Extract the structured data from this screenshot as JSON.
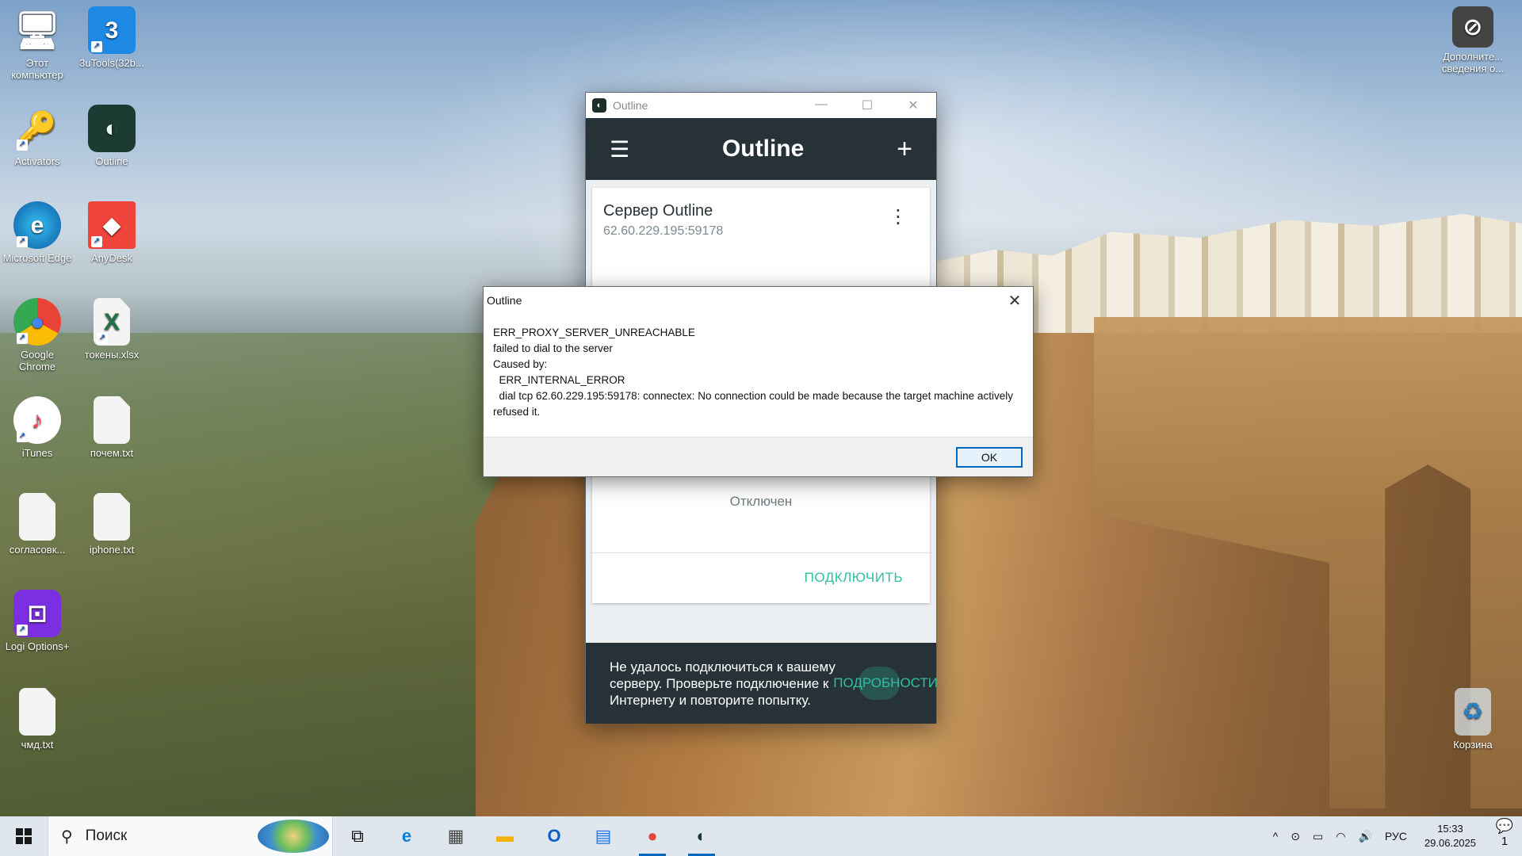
{
  "desktop": {
    "icons": [
      {
        "label": "Этот компьютер",
        "glyph": "🖥"
      },
      {
        "label": "3uTools(32b...",
        "glyph": "3"
      },
      {
        "label": "Activators",
        "glyph": "🔑"
      },
      {
        "label": "Outline",
        "glyph": "◐"
      },
      {
        "label": "Microsoft Edge",
        "glyph": "e"
      },
      {
        "label": "AnyDesk",
        "glyph": "◆"
      },
      {
        "label": "Google Chrome",
        "glyph": "●"
      },
      {
        "label": "токены.xlsx",
        "glyph": "X"
      },
      {
        "label": "iTunes",
        "glyph": "♪"
      },
      {
        "label": "почем.txt",
        "glyph": ""
      },
      {
        "label": "согласовк...",
        "glyph": ""
      },
      {
        "label": "iphone.txt",
        "glyph": ""
      },
      {
        "label": "Logi Options+",
        "glyph": "⊡"
      },
      {
        "label": "чмд.txt",
        "glyph": ""
      },
      {
        "label": "Дополните... сведения о...",
        "glyph": "⊘"
      },
      {
        "label": "Корзина",
        "glyph": "♻"
      }
    ],
    "shortcut_glyph": "↗"
  },
  "outline_window": {
    "title": "Outline",
    "minimize": "—",
    "maximize": "☐",
    "close": "✕",
    "header_title": "Outline",
    "menu_glyph": "☰",
    "add_glyph": "+",
    "server": {
      "name": "Сервер Outline",
      "address": "62.60.229.195:59178",
      "more_glyph": "⋮",
      "status": "Отключен",
      "connect_label": "ПОДКЛЮЧИТЬ"
    },
    "snackbar": {
      "message": "Не удалось подключиться к вашему серверу. Проверьте подключение к Интернету и повторите попытку.",
      "details_label": "ПОДРОБНОСТИ"
    }
  },
  "error_dialog": {
    "title": "Outline",
    "close": "✕",
    "message": "ERR_PROXY_SERVER_UNREACHABLE\nfailed to dial to the server\nCaused by:\n  ERR_INTERNAL_ERROR\n  dial tcp 62.60.229.195:59178: connectex: No connection could be made because the target machine actively refused it.",
    "ok_label": "OK"
  },
  "taskbar": {
    "start_glyph": "⊞",
    "search_placeholder": "Поиск",
    "search_glyph": "⚲",
    "apps": [
      {
        "name": "task-view",
        "glyph": "⧉"
      },
      {
        "name": "edge",
        "glyph": "e"
      },
      {
        "name": "calculator",
        "glyph": "▦"
      },
      {
        "name": "file-explorer",
        "glyph": "▬"
      },
      {
        "name": "outlook",
        "glyph": "O"
      },
      {
        "name": "calendar",
        "glyph": "▤"
      },
      {
        "name": "chrome",
        "glyph": "●"
      },
      {
        "name": "outline",
        "glyph": "◐"
      }
    ],
    "tray": {
      "chevron": "^",
      "meet": "⊙",
      "battery": "▭",
      "network": "◠",
      "volume": "🔊",
      "language": "РУС",
      "time": "15:33",
      "date": "29.06.2025",
      "notifications": "💬",
      "notification_count": "1"
    }
  }
}
